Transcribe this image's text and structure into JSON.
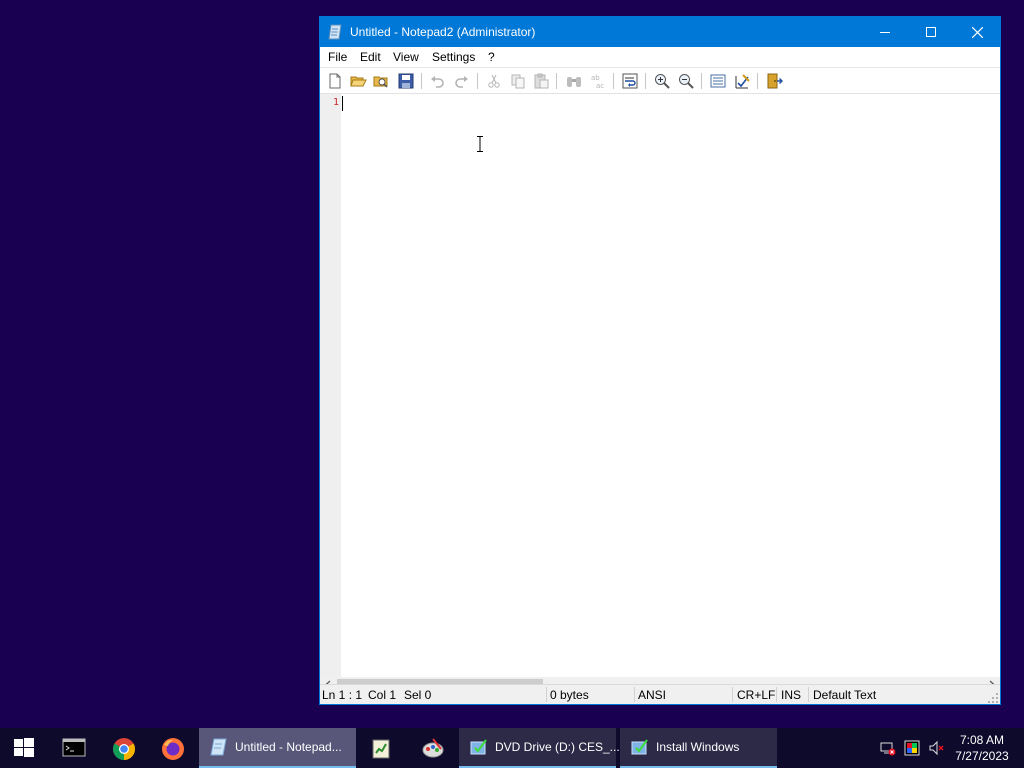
{
  "window": {
    "title": "Untitled - Notepad2 (Administrator)",
    "controls": {
      "minimize_icon": "minimize-icon",
      "maximize_icon": "maximize-icon",
      "close_icon": "close-icon"
    }
  },
  "menu": {
    "items": [
      "File",
      "Edit",
      "View",
      "Settings",
      "?"
    ]
  },
  "toolbar": {
    "buttons": [
      "new",
      "open",
      "browse",
      "save",
      "undo",
      "redo",
      "cut",
      "copy",
      "paste",
      "find",
      "replace",
      "word-wrap",
      "zoom-in",
      "zoom-out",
      "scheme",
      "customize-scheme",
      "exit"
    ]
  },
  "editor": {
    "line_numbers": [
      "1"
    ],
    "content": ""
  },
  "status": {
    "ln": "Ln 1 : 1",
    "col": "Col 1",
    "sel": "Sel 0",
    "bytes": "0 bytes",
    "encoding": "ANSI",
    "line_endings": "CR+LF",
    "mode": "INS",
    "scheme": "Default Text"
  },
  "taskbar": {
    "pinned": [
      "start",
      "command-prompt",
      "chrome",
      "firefox"
    ],
    "tasks": [
      {
        "label": "Untitled - Notepad...",
        "active": true
      },
      {
        "label": "DVD Drive (D:) CES_...",
        "active": false
      },
      {
        "label": "Install Windows",
        "active": false
      }
    ],
    "clock": {
      "time": "7:08 AM",
      "date": "7/27/2023"
    }
  },
  "colors": {
    "accent": "#0078d7",
    "desktop": "#1a0050",
    "taskbar": "#0d0a2c",
    "line_number": "#c62828"
  }
}
